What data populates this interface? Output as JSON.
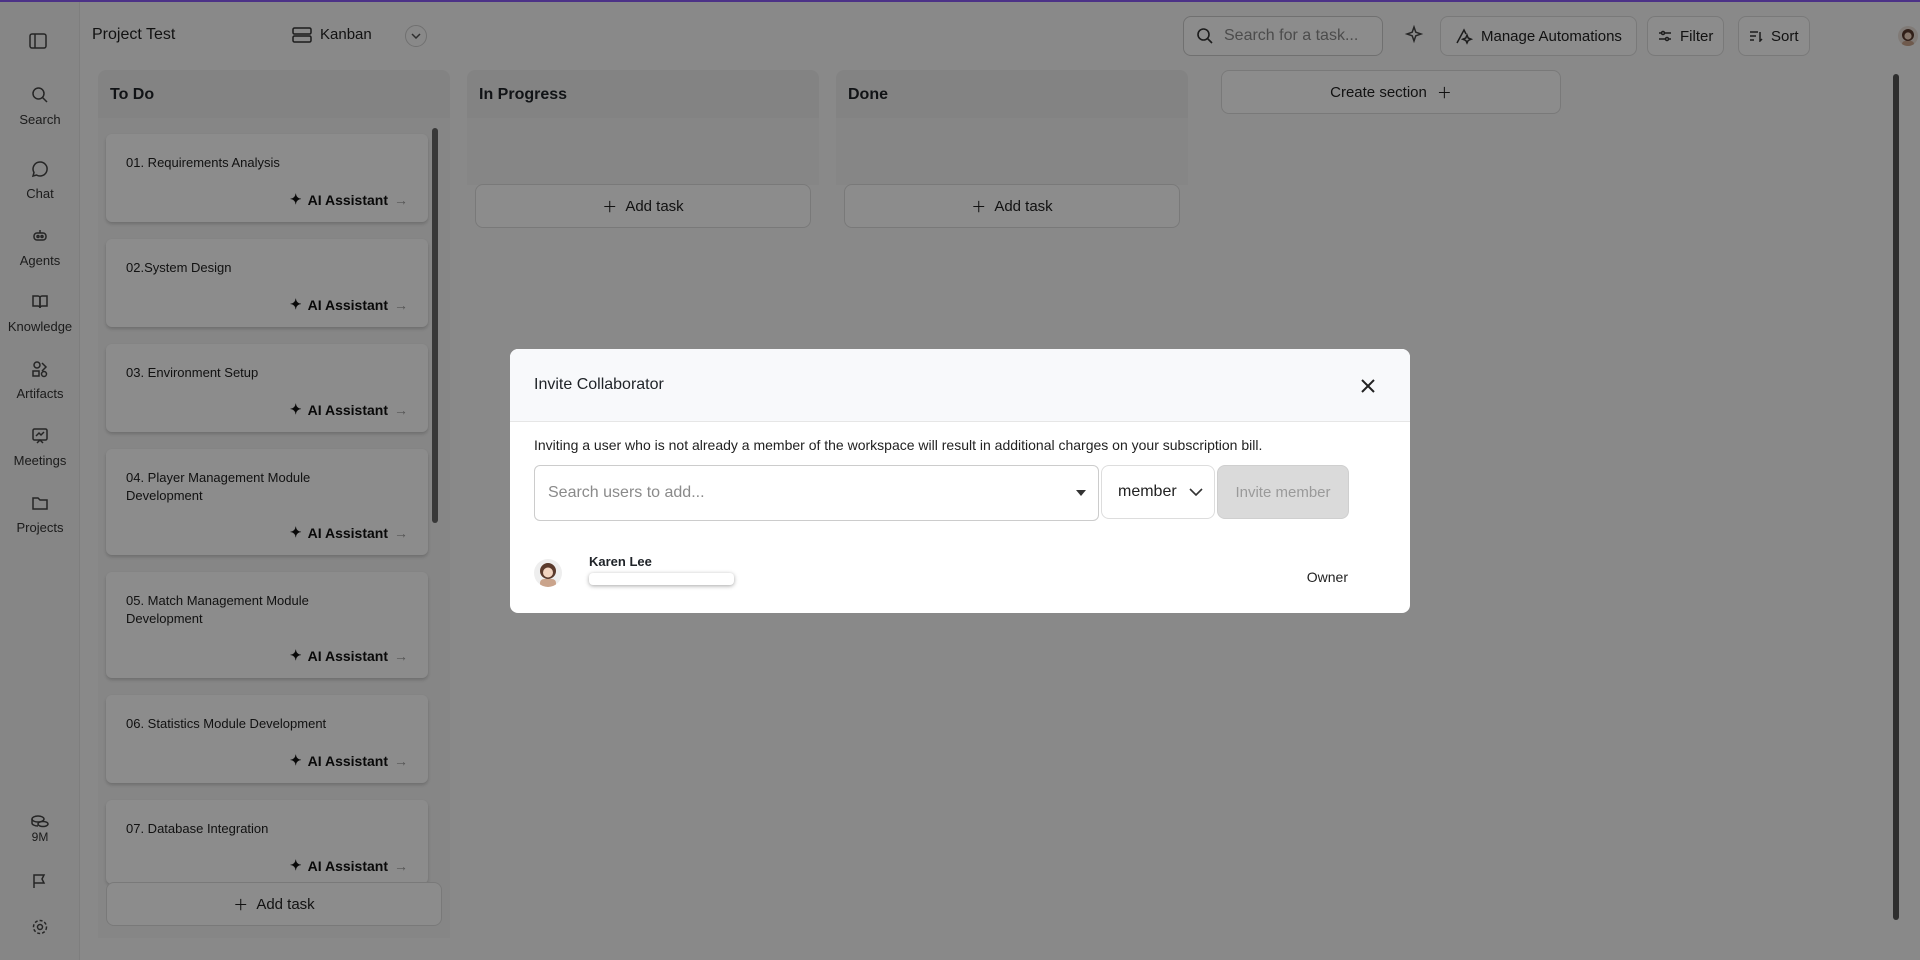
{
  "project_title": "Project Test",
  "view": {
    "label": "Kanban"
  },
  "search": {
    "placeholder": "Search for a task..."
  },
  "toolbar": {
    "automations_label": "Manage Automations",
    "filter_label": "Filter",
    "sort_label": "Sort"
  },
  "sidebar": {
    "items": [
      {
        "label": "Search",
        "icon": "search-icon"
      },
      {
        "label": "Chat",
        "icon": "chat-icon"
      },
      {
        "label": "Agents",
        "icon": "agents-icon"
      },
      {
        "label": "Knowledge",
        "icon": "book-icon"
      },
      {
        "label": "Artifacts",
        "icon": "artifacts-icon"
      },
      {
        "label": "Meetings",
        "icon": "meetings-icon"
      },
      {
        "label": "Projects",
        "icon": "folder-icon"
      }
    ],
    "credits": "9M"
  },
  "board": {
    "columns": [
      {
        "title": "To Do"
      },
      {
        "title": "In Progress"
      },
      {
        "title": "Done"
      }
    ],
    "todo_tasks": [
      {
        "title": "01. Requirements Analysis"
      },
      {
        "title": "02.System Design"
      },
      {
        "title": "03. Environment Setup"
      },
      {
        "title": "04. Player Management Module Development"
      },
      {
        "title": "05. Match Management Module Development"
      },
      {
        "title": "06. Statistics Module Development"
      },
      {
        "title": "07. Database Integration"
      }
    ],
    "ai_label": "AI Assistant",
    "add_task_label": "Add task",
    "create_section_label": "Create section"
  },
  "modal": {
    "title": "Invite Collaborator",
    "note": "Inviting a user who is not already a member of the workspace will result in additional charges on your subscription bill.",
    "search_placeholder": "Search users to add...",
    "role": "member",
    "invite_label": "Invite member",
    "member": {
      "name": "Karen Lee",
      "role": "Owner"
    }
  },
  "colors": {
    "accent": "#8b5cf6",
    "overlay": "rgba(0,0,0,0.45)"
  }
}
